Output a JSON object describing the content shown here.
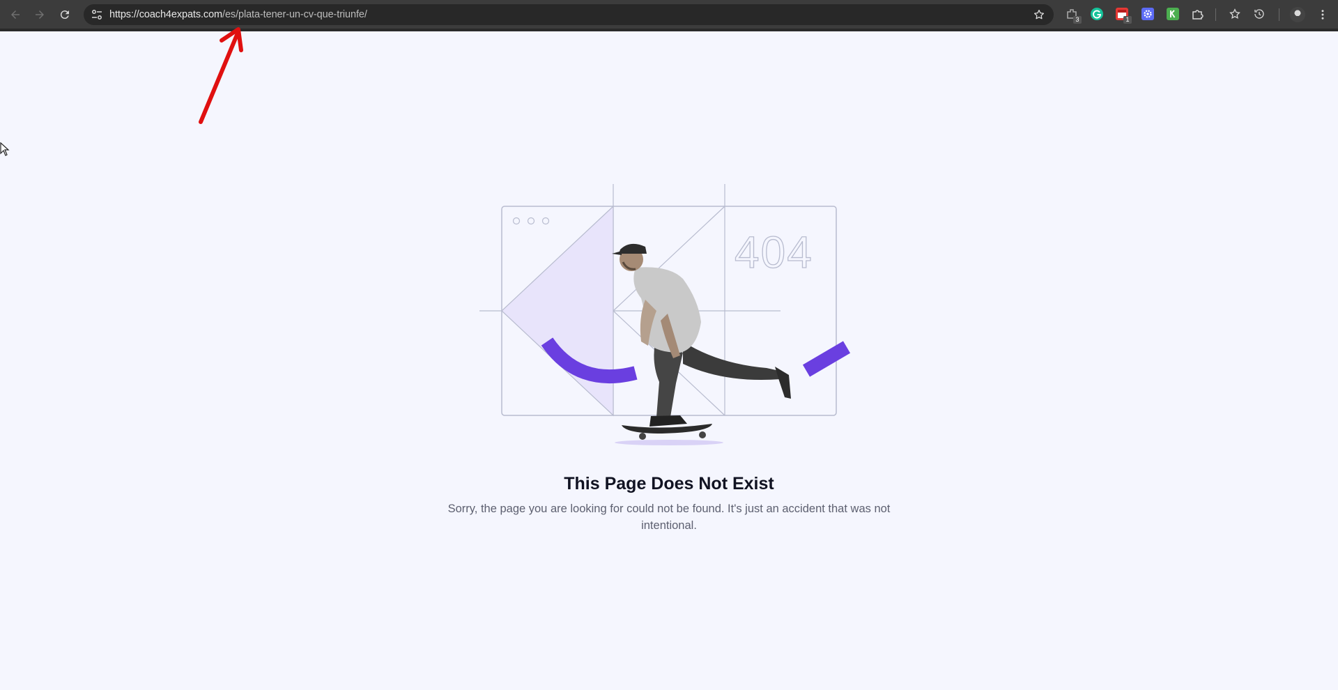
{
  "browser": {
    "url_domain": "https://coach4expats.com",
    "url_path": "/es/plata-tener-un-cv-que-triunfe/",
    "nav": {
      "back_icon": "arrow-left-icon",
      "forward_icon": "arrow-right-icon",
      "reload_icon": "reload-icon"
    },
    "extensions": [
      {
        "icon": "extension-puzzle-icon",
        "badge": "3",
        "color": "#9e9e9e"
      },
      {
        "icon": "grammarly-icon",
        "badge": "",
        "color": "#15c39a"
      },
      {
        "icon": "calendar-icon",
        "badge": "1",
        "color": "#e53935"
      },
      {
        "icon": "gear-extension-icon",
        "badge": "",
        "color": "#5c6bf5"
      },
      {
        "icon": "k-extension-icon",
        "badge": "",
        "color": "#4caf50"
      }
    ]
  },
  "illustration": {
    "code_text": "404",
    "accent_color": "#6a3fe0",
    "panel_fill": "#e8e4fb",
    "line_color": "#b8bccf"
  },
  "main": {
    "title": "This Page Does Not Exist",
    "description": "Sorry, the page you are looking for could not be found. It's just an accident that was not intentional."
  },
  "annotation": {
    "color": "#e01010"
  }
}
